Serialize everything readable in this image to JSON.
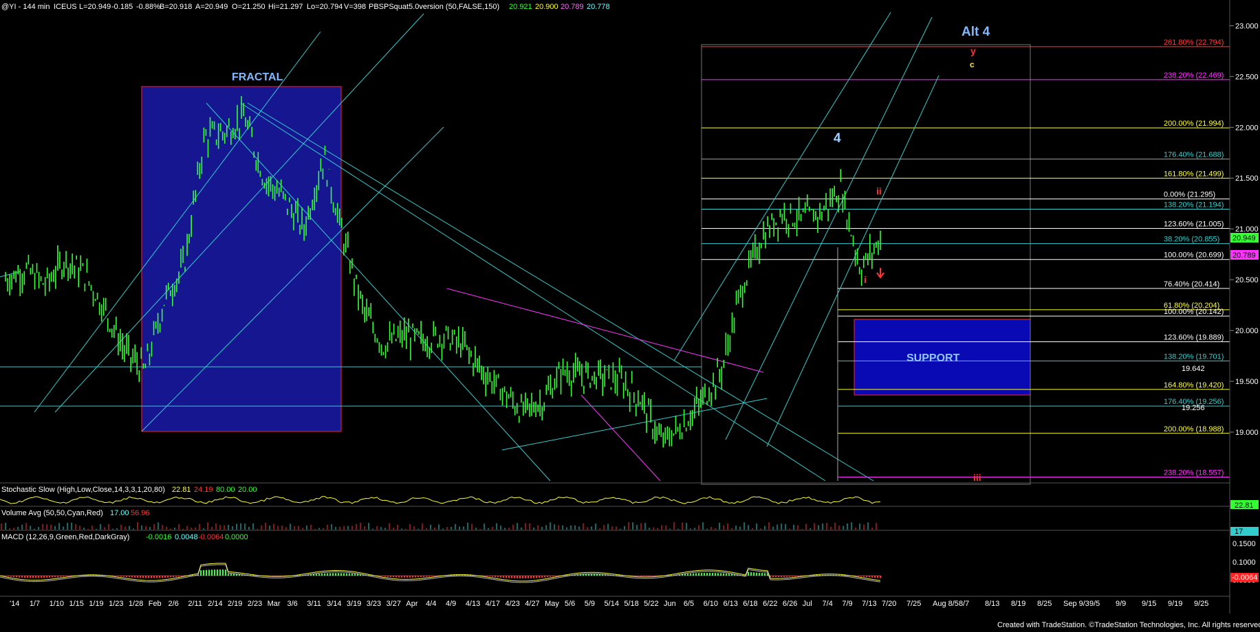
{
  "header": {
    "symbol": "@YI - 144 min",
    "exchange": "ICEUS",
    "last": "L=20.949",
    "change": "-0.185",
    "change_pct": "-0.88%",
    "bid": "B=20.918",
    "ask": "A=20.949",
    "open": "O=21.250",
    "high": "Hi=21.297",
    "low": "Lo=20.794",
    "volume": "V=398",
    "indicator": "PBSPSquat5.0version (50,FALSE,150)",
    "ind_values": [
      "20.921",
      "20.900",
      "20.789",
      "20.778"
    ]
  },
  "price_axis": {
    "labels": [
      "23.000",
      "22.500",
      "22.000",
      "21.500",
      "21.000",
      "20.500",
      "20.000",
      "19.500",
      "19.000"
    ],
    "current": "20.949",
    "marker_low": "20.789"
  },
  "time_axis": [
    "'14",
    "1/7",
    "1/10",
    "1/15",
    "1/19",
    "1/23",
    "1/28",
    "Feb",
    "2/6",
    "2/11",
    "2/14",
    "2/19",
    "2/23",
    "Mar",
    "3/6",
    "3/11",
    "3/14",
    "3/19",
    "3/23",
    "3/27",
    "Apr",
    "4/4",
    "4/9",
    "4/13",
    "4/17",
    "4/23",
    "4/27",
    "May",
    "5/6",
    "5/9",
    "5/14",
    "5/18",
    "5/22",
    "Jun",
    "6/5",
    "6/10",
    "6/13",
    "6/18",
    "6/22",
    "6/26",
    "Jul",
    "7/4",
    "7/9",
    "7/13",
    "7/20",
    "7/25",
    "Aug 8/5",
    "8/7",
    "8/13",
    "8/19",
    "8/25",
    "Sep 9/3",
    "9/5",
    "9/9",
    "9/15",
    "9/19",
    "9/25"
  ],
  "fib_levels": [
    {
      "label": "261.80% (22.794)",
      "price": 22.794,
      "color": "#ff3b3b"
    },
    {
      "label": "238.20% (22.469)",
      "price": 22.469,
      "color": "#ff33ff"
    },
    {
      "label": "200.00% (21.994)",
      "price": 21.994,
      "color": "#ffff33"
    },
    {
      "label": "176.40% (21.688)",
      "price": 21.688,
      "color": "#33cccc"
    },
    {
      "label": "161.80% (21.499)",
      "price": 21.499,
      "color": "#ffff33"
    },
    {
      "label": "0.00% (21.295)",
      "price": 21.295,
      "color": "#ffffff"
    },
    {
      "label": "138.20% (21.194)",
      "price": 21.194,
      "color": "#33cccc"
    },
    {
      "label": "123.60% (21.005)",
      "price": 21.005,
      "color": "#ffffff"
    },
    {
      "label": "38.20% (20.855)",
      "price": 20.855,
      "color": "#33cccc"
    },
    {
      "label": "100.00% (20.699)",
      "price": 20.699,
      "color": "#ffffff"
    },
    {
      "label": "76.40% (20.414)",
      "price": 20.414,
      "color": "#ffffff"
    },
    {
      "label": "61.80% (20.204)",
      "price": 20.204,
      "color": "#ffff33"
    },
    {
      "label": "100.00% (20.142)",
      "price": 20.142,
      "color": "#ffffff"
    },
    {
      "label": "123.60% (19.889)",
      "price": 19.889,
      "color": "#ffffff"
    },
    {
      "label": "138.20% (19.701)",
      "price": 19.701,
      "color": "#33cccc"
    },
    {
      "label": "164.80% (19.420)",
      "price": 19.42,
      "color": "#ffff33"
    },
    {
      "label": "176.40% (19.256)",
      "price": 19.256,
      "color": "#33cccc"
    },
    {
      "label": "200.00% (18.988)",
      "price": 18.988,
      "color": "#ffff33"
    },
    {
      "label": "238.20% (18.557)",
      "price": 18.557,
      "color": "#ff33ff"
    }
  ],
  "right_price_marks": [
    "19.642",
    "19.256"
  ],
  "annotations": {
    "fractal": "FRACTAL",
    "support": "SUPPORT",
    "alt4": "Alt 4",
    "wave4": "4",
    "wave_y": "y",
    "wave_c": "c",
    "wave_ii": "ii",
    "wave_i": "i",
    "wave_iii": "iii"
  },
  "stochastic": {
    "label": "Stochastic Slow (High,Low,Close,14,3,3,1,20,80)",
    "values": [
      "22.81",
      "24.19",
      "80.00",
      "20.00"
    ],
    "axis_value": "22.81"
  },
  "volume": {
    "label": "Volume Avg (50,50,Cyan,Red)",
    "values": [
      "17.00",
      "56.96"
    ],
    "axis_value": "17"
  },
  "macd": {
    "label": "MACD (12,26,9,Green,Red,DarkGray)",
    "values": [
      "-0.0016",
      "0.0048",
      "-0.0064",
      "0.0000"
    ],
    "axis_labels": [
      "0.1500",
      "0.1000",
      "0.0500"
    ],
    "axis_value": "-0.0064"
  },
  "footer": "Created with TradeStation. ©TradeStation Technologies, Inc. All rights reserved.",
  "colors": {
    "price_bars": "#33ff33",
    "channel": "#33cccc",
    "fractal_box": "#1a1aaa",
    "support_box": "#0a0ab4",
    "box_border": "#ff2222",
    "wedge": "#ff33ff"
  },
  "chart_data": {
    "type": "candlestick",
    "title": "@YI - 144 min",
    "ylim": [
      18.52,
      23.05
    ],
    "x": [
      "'14",
      "1/7",
      "1/10",
      "1/15",
      "1/19",
      "1/23",
      "1/28",
      "Feb",
      "2/6",
      "2/11",
      "2/14",
      "2/19",
      "2/23",
      "Mar",
      "3/6",
      "3/11",
      "3/14",
      "3/19",
      "3/23",
      "3/27",
      "Apr",
      "4/4",
      "4/9",
      "4/13",
      "4/17",
      "4/23",
      "4/27",
      "May",
      "5/6",
      "5/9",
      "5/14",
      "5/18",
      "5/22",
      "Jun",
      "6/5",
      "6/10",
      "6/13",
      "6/18",
      "6/22",
      "6/26",
      "Jul",
      "7/4",
      "7/9",
      "7/13",
      "7/20"
    ],
    "series": [
      {
        "values": [
          20.5,
          20.6,
          20.45,
          20.7,
          20.55,
          20.2,
          19.8,
          19.6,
          20.3,
          20.65,
          21.9,
          21.95,
          22.1,
          21.5,
          21.3,
          21.0,
          21.7,
          20.9,
          20.2,
          19.85,
          19.95,
          19.9,
          19.95,
          19.85,
          19.6,
          19.4,
          19.2,
          19.3,
          19.6,
          19.55,
          19.55,
          19.5,
          19.3,
          18.9,
          19.05,
          19.3,
          19.6,
          20.4,
          20.9,
          21.15,
          21.1,
          21.15,
          21.4,
          20.6,
          20.9
        ]
      }
    ]
  }
}
